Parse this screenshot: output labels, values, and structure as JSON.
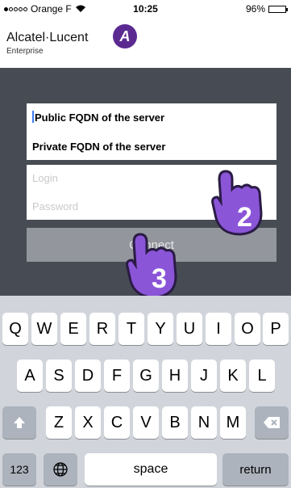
{
  "status_bar": {
    "carrier": "Orange F",
    "time": "10:25",
    "battery_level": "96%",
    "battery_fraction": 0.96
  },
  "header": {
    "brand": "Alcatel·Lucent",
    "subtitle": "Enterprise",
    "logo_letter": "A"
  },
  "form": {
    "public_fqdn_label": "Public FQDN of the server",
    "private_fqdn_label": "Private FQDN of the server",
    "login_placeholder": "Login",
    "password_placeholder": "Password",
    "connect_label": "Connect"
  },
  "hints": {
    "step_two": "2",
    "step_three": "3",
    "hand_color": "#8b55d8"
  },
  "keyboard": {
    "row1": [
      "Q",
      "W",
      "E",
      "R",
      "T",
      "Y",
      "U",
      "I",
      "O",
      "P"
    ],
    "row2": [
      "A",
      "S",
      "D",
      "F",
      "G",
      "H",
      "J",
      "K",
      "L"
    ],
    "row3": [
      "Z",
      "X",
      "C",
      "V",
      "B",
      "N",
      "M"
    ],
    "numbers_key": "123",
    "space_key": "space",
    "return_key": "return",
    "icons": {
      "shift": "shift-icon",
      "delete": "delete-icon",
      "globe": "globe-icon"
    }
  },
  "colors": {
    "panel": "#474c54",
    "button": "#93969c",
    "keyboard": "#d1d5db",
    "brand_purple": "#5a2a91",
    "cursor": "#3d7bf6"
  }
}
